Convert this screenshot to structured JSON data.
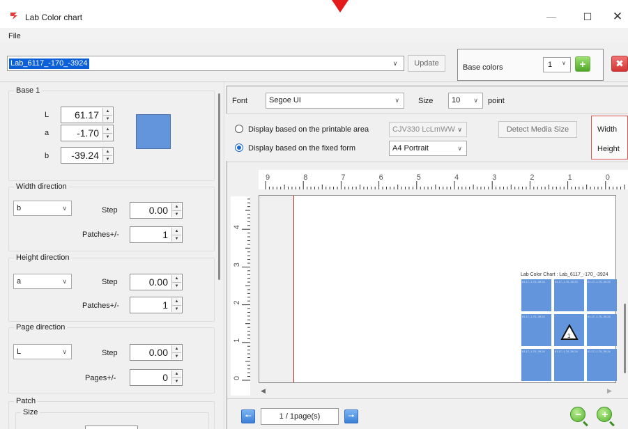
{
  "window": {
    "title": "Lab Color chart",
    "minimize_glyph": "—",
    "maximize_glyph": "☐",
    "close_glyph": "✕"
  },
  "menu": {
    "file": "File"
  },
  "toolbar": {
    "profile_value": "Lab_6117_-170_-3924",
    "update_label": "Update",
    "base_colors_label": "Base colors",
    "base_colors_count": "1",
    "add_glyph": "+",
    "remove_glyph": "✖"
  },
  "base": {
    "title": "Base 1",
    "L_label": "L",
    "L_value": "61.17",
    "a_label": "a",
    "a_value": "-1.70",
    "b_label": "b",
    "b_value": "-39.24",
    "swatch_color": "#6395dc"
  },
  "width_direction": {
    "title": "Width direction",
    "axis": "b",
    "step_label": "Step",
    "step_value": "0.00",
    "patches_label": "Patches+/-",
    "patches_value": "1"
  },
  "height_direction": {
    "title": "Height direction",
    "axis": "a",
    "step_label": "Step",
    "step_value": "0.00",
    "patches_label": "Patches+/-",
    "patches_value": "1"
  },
  "page_direction": {
    "title": "Page direction",
    "axis": "L",
    "step_label": "Step",
    "step_value": "0.00",
    "pages_label": "Pages+/-",
    "pages_value": "0"
  },
  "patch": {
    "title": "Patch",
    "size_label": "Size"
  },
  "font_bar": {
    "font_label": "Font",
    "font_value": "Segoe UI",
    "size_label": "Size",
    "size_value": "10",
    "unit": "point"
  },
  "display": {
    "printable_label": "Display based on the printable area",
    "fixed_label": "Display based on the fixed form",
    "selected": "fixed",
    "printer_value": "CJV330 LcLmWW",
    "form_value": "A4 Portrait",
    "detect_label": "Detect Media Size",
    "width_label": "Width",
    "height_label": "Height"
  },
  "ruler": {
    "h_numbers": [
      "9",
      "8",
      "7",
      "6",
      "5",
      "4",
      "3",
      "2",
      "1",
      "0"
    ],
    "v_numbers": [
      "4",
      "3",
      "2",
      "1",
      "0"
    ]
  },
  "preview": {
    "chart_title": "Lab Color Chart : Lab_6117_-170_-3924",
    "patch_color": "#6395dc",
    "margin_color": "#c0262c",
    "patch_labels": [
      "61.17,-1.70,-39.24",
      "61.17,-1.70,-39.24",
      "61.17,-1.70,-39.24",
      "61.17,-1.70,-39.24",
      "",
      "61.17,-1.70,-39.24",
      "61.17,-1.70,-39.24",
      "61.17,-1.70,-39.24",
      "61.17,-1.70,-39.24"
    ],
    "center_marker_label": "1"
  },
  "pager": {
    "page_text": "1 / 1page(s)"
  }
}
